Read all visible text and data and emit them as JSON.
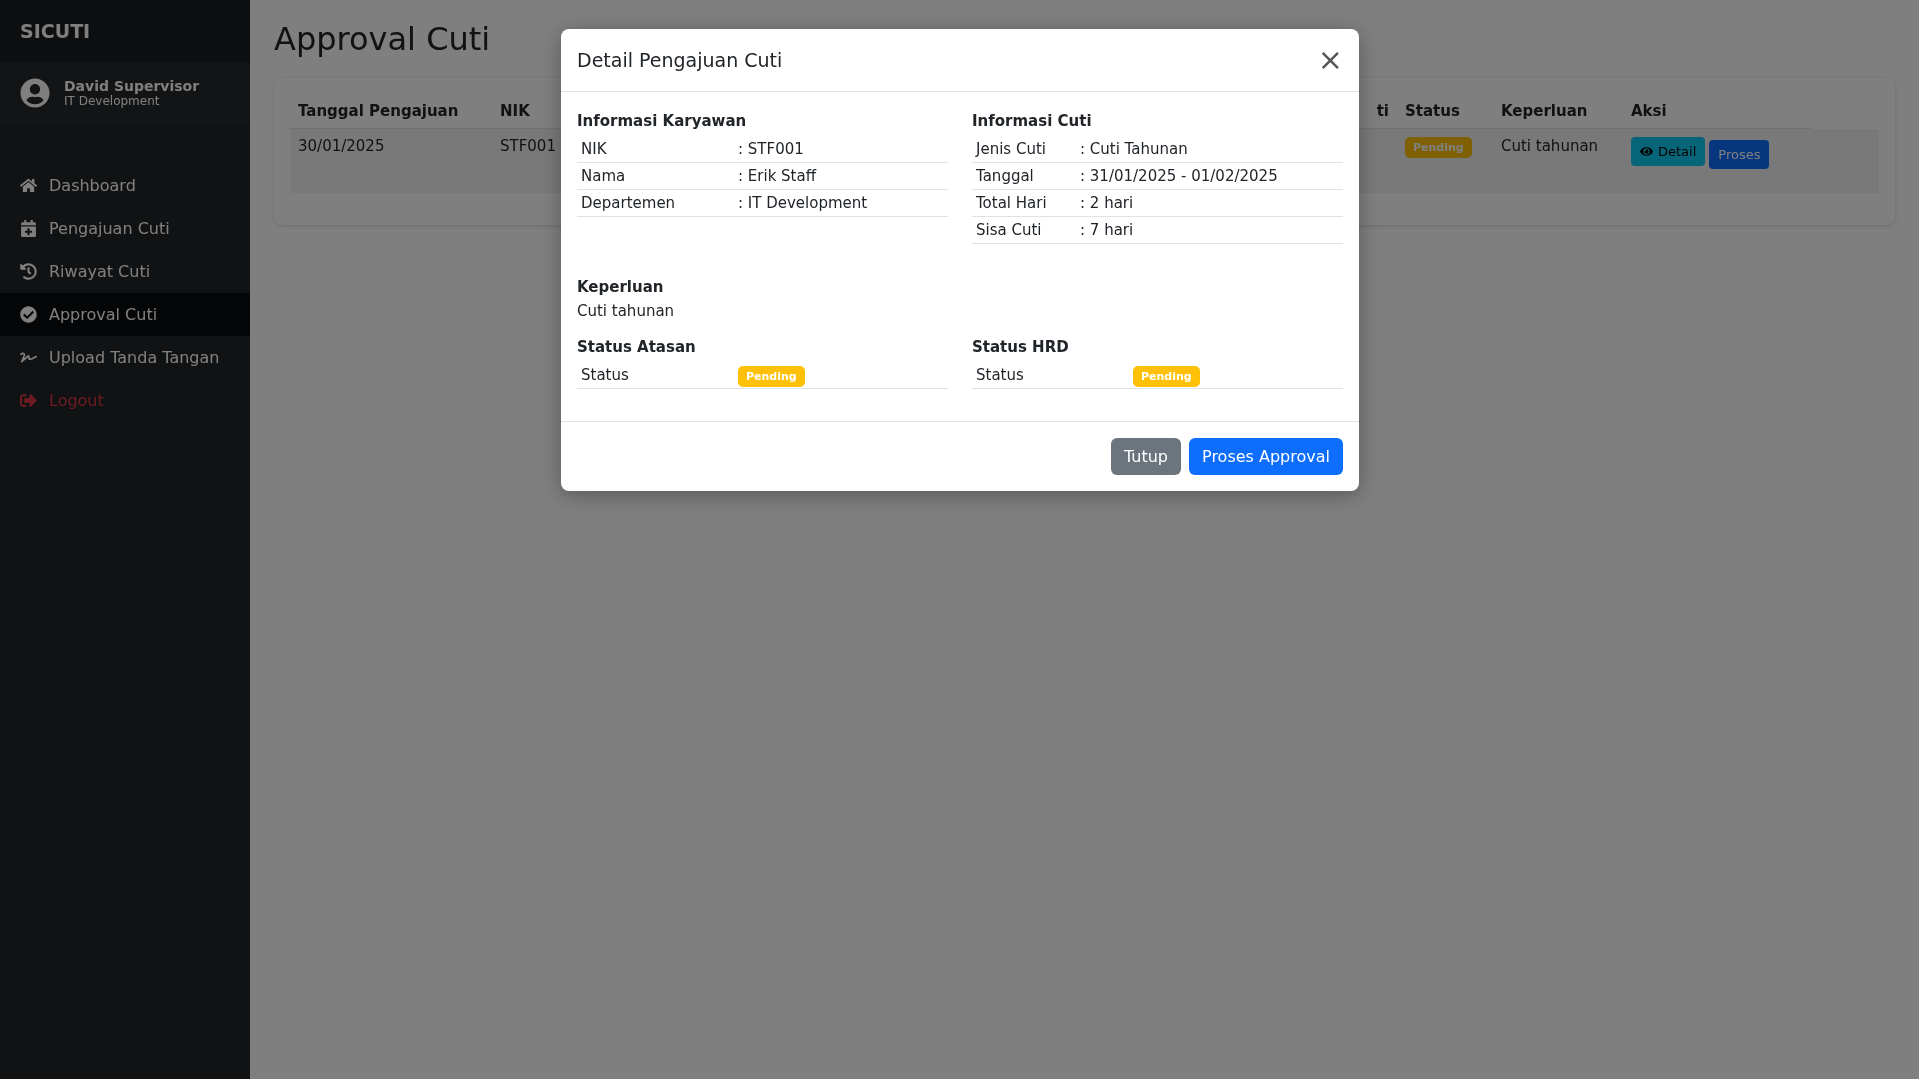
{
  "sidebar": {
    "brand": "SICUTI",
    "user": {
      "name": "David Supervisor",
      "department": "IT Development"
    },
    "items": [
      {
        "label": "Dashboard",
        "selected": false,
        "kind": "nav"
      },
      {
        "label": "Pengajuan Cuti",
        "selected": false,
        "kind": "nav"
      },
      {
        "label": "Riwayat Cuti",
        "selected": false,
        "kind": "nav"
      },
      {
        "label": "Approval Cuti",
        "selected": true,
        "kind": "nav"
      },
      {
        "label": "Upload Tanda Tangan",
        "selected": false,
        "kind": "nav"
      },
      {
        "label": "Logout",
        "selected": false,
        "kind": "logout"
      }
    ]
  },
  "page": {
    "title": "Approval Cuti"
  },
  "table": {
    "columns": [
      "Tanggal Pengajuan",
      "NIK",
      "ti",
      "Status",
      "Keperluan",
      "Aksi"
    ],
    "rows": [
      {
        "tanggal_pengajuan": "30/01/2025",
        "nik": "STF001",
        "status": "Pending",
        "keperluan": "Cuti tahunan",
        "actions": [
          {
            "label": "Detail",
            "kind": "detail"
          },
          {
            "label": "Proses",
            "kind": "proses"
          }
        ]
      }
    ]
  },
  "modal": {
    "title": "Detail Pengajuan Cuti",
    "close": "×",
    "sections": [
      {
        "title": "Informasi Karyawan",
        "rows": [
          {
            "label": "NIK",
            "value": ": STF001"
          },
          {
            "label": "Nama",
            "value": ": Erik Staff"
          },
          {
            "label": "Departemen",
            "value": ": IT Development"
          }
        ]
      },
      {
        "title": "Informasi Cuti",
        "rows": [
          {
            "label": "Jenis Cuti",
            "value": ": Cuti Tahunan"
          },
          {
            "label": "Tanggal",
            "value": ": 31/01/2025 - 01/02/2025"
          },
          {
            "label": "Total Hari",
            "value": ": 2 hari"
          },
          {
            "label": "Sisa Cuti",
            "value": ": 7 hari"
          }
        ]
      }
    ],
    "keperluan": {
      "title": "Keperluan",
      "text": "Cuti tahunan"
    },
    "statuses": [
      {
        "title": "Status Atasan",
        "label": "Status",
        "badge": "Pending"
      },
      {
        "title": "Status HRD",
        "label": "Status",
        "badge": "Pending"
      }
    ],
    "buttons": [
      {
        "label": "Tutup",
        "kind": "secondary"
      },
      {
        "label": "Proses Approval",
        "kind": "primary"
      }
    ]
  }
}
